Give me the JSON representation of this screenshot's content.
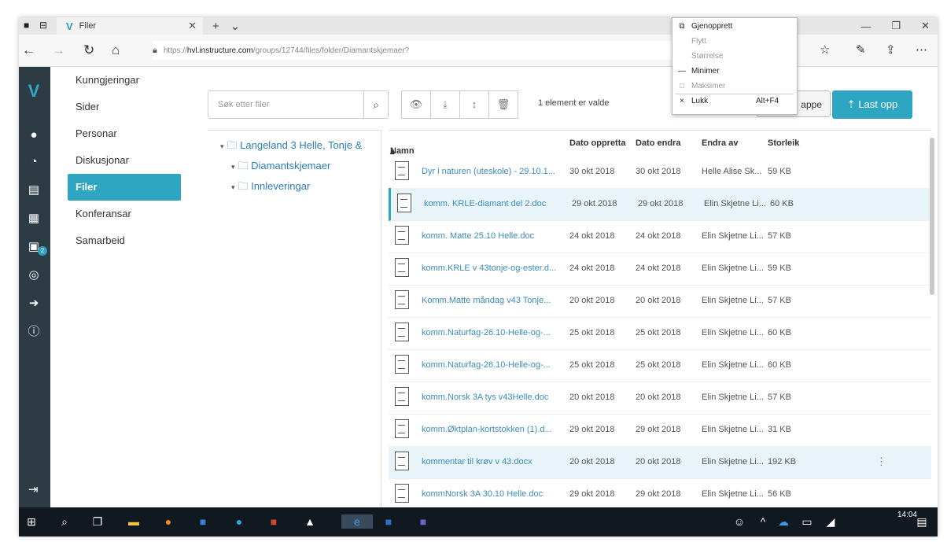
{
  "browser": {
    "tab_title": "Filer",
    "url_prefix": "https://",
    "url_host": "hvl.instructure.com",
    "url_path": "/groups/12744/files/folder/Diamantskjemaer?"
  },
  "window_menu": {
    "items": [
      {
        "glyph": "⧉",
        "label": "Gjenopprett",
        "shortcut": "",
        "disabled": false
      },
      {
        "glyph": "",
        "label": "Flytt",
        "shortcut": "",
        "disabled": true
      },
      {
        "glyph": "",
        "label": "Størrelse",
        "shortcut": "",
        "disabled": true
      },
      {
        "glyph": "—",
        "label": "Minimer",
        "shortcut": "",
        "disabled": false
      },
      {
        "glyph": "□",
        "label": "Maksimer",
        "shortcut": "",
        "disabled": true
      },
      {
        "glyph": "×",
        "label": "Lukk",
        "shortcut": "Alt+F4",
        "disabled": false
      }
    ]
  },
  "course_nav": [
    {
      "label": "Kunngjeringar",
      "active": false
    },
    {
      "label": "Sider",
      "active": false
    },
    {
      "label": "Personar",
      "active": false
    },
    {
      "label": "Diskusjonar",
      "active": false
    },
    {
      "label": "Filer",
      "active": true
    },
    {
      "label": "Konferansar",
      "active": false
    },
    {
      "label": "Samarbeid",
      "active": false
    }
  ],
  "global_nav_badge": "2",
  "toolbar": {
    "search_placeholder": "Søk etter filer",
    "selected_text": "1 element er valde",
    "folder_button": "appe",
    "upload_button": "Last opp"
  },
  "tree": {
    "root": "Langeland 3 Helle, Tonje &",
    "children": [
      "Diamantskjemaer",
      "Innleveringar"
    ]
  },
  "columns": {
    "name": "Namn",
    "created": "Dato oppretta",
    "modified": "Dato endra",
    "modified_by": "Endra av",
    "size": "Storleik"
  },
  "files": [
    {
      "name": "Dyr i naturen (uteskole) - 29.10.1...",
      "created": "30 okt 2018",
      "modified": "30 okt 2018",
      "by": "Helle Alise Sk...",
      "size": "59 KB"
    },
    {
      "name": "komm. KRLE-diamant del 2.doc",
      "created": "29 okt 2018",
      "modified": "29 okt 2018",
      "by": "Elin Skjetne Li...",
      "size": "60 KB"
    },
    {
      "name": "komm. Matte 25.10 Helle.doc",
      "created": "24 okt 2018",
      "modified": "24 okt 2018",
      "by": "Elin Skjetne Li...",
      "size": "57 KB"
    },
    {
      "name": "komm.KRLE v 43tonje-og-ester.d...",
      "created": "24 okt 2018",
      "modified": "24 okt 2018",
      "by": "Elin Skjetne Li...",
      "size": "59 KB"
    },
    {
      "name": "Komm.Matte måndag v43 Tonje...",
      "created": "20 okt 2018",
      "modified": "20 okt 2018",
      "by": "Elin Skjetne Li...",
      "size": "57 KB"
    },
    {
      "name": "komm.Naturfag-26.10-Helle-og-...",
      "created": "25 okt 2018",
      "modified": "25 okt 2018",
      "by": "Elin Skjetne Li...",
      "size": "60 KB"
    },
    {
      "name": "komm.Naturfag-26.10-Helle-og-...",
      "created": "25 okt 2018",
      "modified": "25 okt 2018",
      "by": "Elin Skjetne Li...",
      "size": "60 KB"
    },
    {
      "name": "komm.Norsk 3A tys v43Helle.doc",
      "created": "20 okt 2018",
      "modified": "20 okt 2018",
      "by": "Elin Skjetne Li...",
      "size": "57 KB"
    },
    {
      "name": "komm.Øktplan-kortstokken (1).d...",
      "created": "29 okt 2018",
      "modified": "29 okt 2018",
      "by": "Elin Skjetne Li...",
      "size": "31 KB"
    },
    {
      "name": "kommentar til krøv v 43.docx",
      "created": "20 okt 2018",
      "modified": "20 okt 2018",
      "by": "Elin Skjetne Li...",
      "size": "192 KB"
    },
    {
      "name": "kommNorsk 3A 30.10 Helle.doc",
      "created": "29 okt 2018",
      "modified": "29 okt 2018",
      "by": "Elin Skjetne Li...",
      "size": "56 KB"
    }
  ],
  "clock": {
    "time": "14:04"
  },
  "colors": {
    "accent": "#2fa6c1",
    "global_nav": "#2d3b45",
    "taskbar": "#101820"
  }
}
